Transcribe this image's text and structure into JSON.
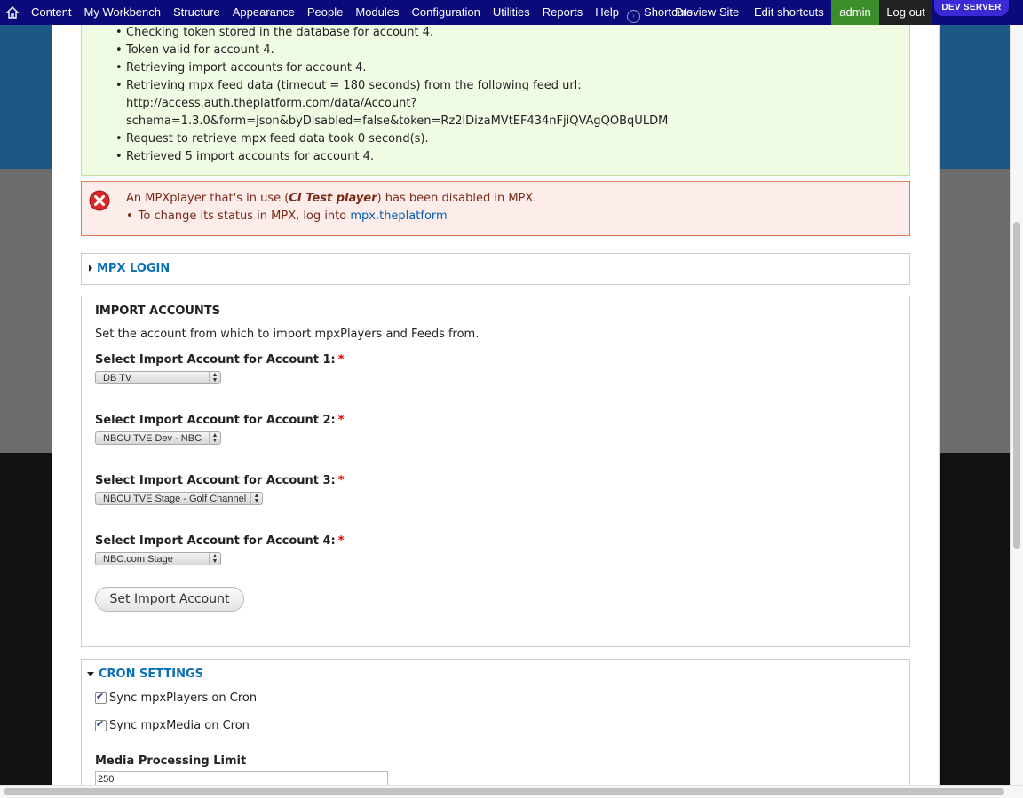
{
  "toolbar": {
    "items": [
      "Content",
      "My Workbench",
      "Structure",
      "Appearance",
      "People",
      "Modules",
      "Configuration",
      "Utilities",
      "Reports",
      "Help"
    ],
    "shortcuts_label": "Shortcuts",
    "preview_site": "Preview Site",
    "edit_shortcuts": "Edit shortcuts",
    "admin": "admin",
    "logout": "Log out",
    "dev_server": "DEV SERVER",
    "colors": {
      "bar": "#0a0a7a",
      "admin": "#3c8d2c",
      "dev_badge": "#3a2ad6"
    }
  },
  "status_messages": [
    "Checking token stored in the database for account 4.",
    "Token valid for account 4.",
    "Retrieving import accounts for account 4.",
    "Retrieving mpx feed data (timeout = 180 seconds) from the following feed url:",
    "http://access.auth.theplatform.com/data/Account?",
    "schema=1.3.0&form=json&byDisabled=false&token=Rz2lDizaMVtEF434nFjiQVAgQOBqULDM",
    "Request to retrieve mpx feed data took 0 second(s).",
    "Retrieved 5 import accounts for account 4."
  ],
  "error": {
    "text_before": "An MPXplayer that's in use (",
    "player": "CI Test player",
    "text_after": ") has been disabled in MPX.",
    "line2": "To change its status in MPX, log into ",
    "link": "mpx.theplatform"
  },
  "mpx_login": {
    "legend": "MPX LOGIN"
  },
  "import_accounts": {
    "title": "IMPORT ACCOUNTS",
    "description": "Set the account from which to import mpxPlayers and Feeds from.",
    "fields": [
      {
        "label": "Select Import Account for Account 1:",
        "value": "DB TV"
      },
      {
        "label": "Select Import Account for Account 2:",
        "value": "NBCU TVE Dev - NBC"
      },
      {
        "label": "Select Import Account for Account 3:",
        "value": "NBCU TVE Stage - Golf Channel"
      },
      {
        "label": "Select Import Account for Account 4:",
        "value": "NBC.com Stage"
      }
    ],
    "required_mark": "*",
    "button": "Set Import Account"
  },
  "cron": {
    "legend": "CRON SETTINGS",
    "sync_players": "Sync mpxPlayers on Cron",
    "sync_media": "Sync mpxMedia on Cron",
    "limit_label": "Media Processing Limit",
    "limit_value": "250"
  }
}
